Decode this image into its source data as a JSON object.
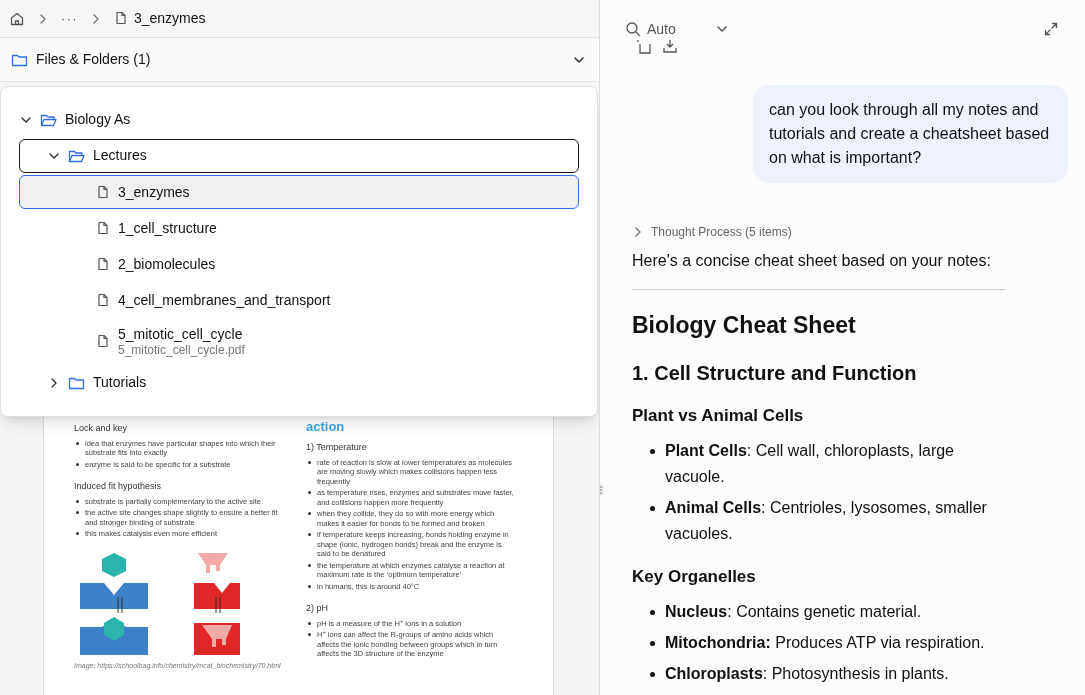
{
  "breadcrumb": {
    "ellipsis": "···",
    "current": "3_enzymes"
  },
  "files_section": {
    "title": "Files & Folders (1)",
    "expanded": true
  },
  "tree": [
    {
      "kind": "folder",
      "label": "Biology As",
      "expanded": true,
      "selected": false,
      "focused": false,
      "children": [
        {
          "kind": "folder",
          "label": "Lectures",
          "expanded": true,
          "selected": false,
          "focused": true,
          "children": [
            {
              "kind": "file",
              "label": "3_enzymes",
              "selected": true,
              "focused": false
            },
            {
              "kind": "file",
              "label": "1_cell_structure",
              "selected": false,
              "focused": false
            },
            {
              "kind": "file",
              "label": "2_biomolecules",
              "selected": false,
              "focused": false
            },
            {
              "kind": "file",
              "label": "4_cell_membranes_and_transport",
              "selected": false,
              "focused": false
            },
            {
              "kind": "file",
              "label": "5_mitotic_cell_cycle",
              "subtitle": "5_mitotic_cell_cycle.pdf",
              "selected": false,
              "focused": false
            }
          ]
        },
        {
          "kind": "folder",
          "label": "Tutorials",
          "expanded": false,
          "selected": false,
          "focused": false
        }
      ]
    }
  ],
  "document": {
    "left_column": [
      {
        "kind": "heading",
        "text": "Lock and key"
      },
      {
        "kind": "bullets",
        "items": [
          "idea that enzymes have particular shapes into which their substrate fits into exactly",
          "enzyme is said to be specific for a substrate"
        ]
      },
      {
        "kind": "heading",
        "text": "Induced fit hypothesis"
      },
      {
        "kind": "bullets",
        "items": [
          "substrate is partially complementary to the active site",
          "the active site changes shape slightly to ensure a better fit and stronger binding of substrate",
          "this makes catalysis even more efficient"
        ]
      },
      {
        "kind": "figure"
      },
      {
        "kind": "caption",
        "text": "Image: https://schoolbag.info/chemistry/mcat_biochemistry/70.html"
      }
    ],
    "right_column": [
      {
        "kind": "title",
        "text": "action"
      },
      {
        "kind": "heading",
        "text": "1) Temperature"
      },
      {
        "kind": "bullets",
        "items": [
          "rate of reaction is slow at lower temperatures as molecules are moving slowly which makes collisions happen less frequently",
          "as temperature rises, enzymes and substrates move faster, and collisions happen more frequently",
          "when they collide, they do so with more energy which makes it easier for bonds to be formed and broken",
          "if temperature keeps increasing, bonds holding enzyme in shape (ionic, hydrogen bonds) break and the enzyme is said to be denatured",
          "the temperature at which enzymes catalyse a reaction at maximum rate is the ‘optimum temperature’",
          "in humans, this is around 40°C"
        ]
      },
      {
        "kind": "heading",
        "text": "2) pH"
      },
      {
        "kind": "bullets",
        "items": [
          "pH is a measure of the H$^{+}$ ions in a solution",
          "H$^{+}$ ions can affect the R-groups of amino acids which affects the ionic bonding between groups which in turn affects the 3D structure of the enzyme"
        ]
      }
    ]
  },
  "chat_header": {
    "mode": "Auto"
  },
  "user_message": "can you look through all my notes and tutorials and create a cheatsheet based on what is important?",
  "thought_process": {
    "label": "Thought Process (5 items)",
    "expanded": false
  },
  "response": [
    {
      "kind": "paragraph",
      "text": "Here's a concise cheat sheet based on your notes:"
    },
    {
      "kind": "rule"
    },
    {
      "kind": "h1",
      "text": "Biology Cheat Sheet"
    },
    {
      "kind": "h2",
      "text": "1. Cell Structure and Function"
    },
    {
      "kind": "h3",
      "text": "Plant vs Animal Cells"
    },
    {
      "kind": "bullets",
      "items": [
        "**Plant Cells**: Cell wall, chloroplasts, large vacuole.",
        "**Animal Cells**: Centrioles, lysosomes, smaller vacuoles."
      ]
    },
    {
      "kind": "h3",
      "text": "Key Organelles"
    },
    {
      "kind": "bullets",
      "items": [
        "**Nucleus**: Contains genetic material.",
        "**Mitochondria:** Produces ATP via respiration.",
        "**Chloroplasts**: Photosynthesis in plants."
      ]
    }
  ]
}
